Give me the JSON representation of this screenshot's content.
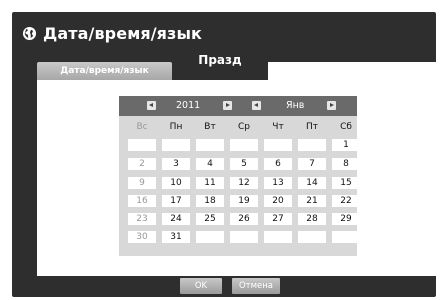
{
  "window": {
    "title": "Дата/время/язык",
    "title_icon": "globe-icon"
  },
  "tabs": [
    {
      "label": "Дата/время/язык",
      "active": false
    },
    {
      "label": "Празд",
      "active": true
    }
  ],
  "calendar": {
    "year": "2011",
    "month": "Янв",
    "weekdays": [
      "Вс",
      "Пн",
      "Вт",
      "Ср",
      "Чт",
      "Пт",
      "Сб"
    ],
    "weeks": [
      [
        "",
        "",
        "",
        "",
        "",
        "",
        "1"
      ],
      [
        "2",
        "3",
        "4",
        "5",
        "6",
        "7",
        "8"
      ],
      [
        "9",
        "10",
        "11",
        "12",
        "13",
        "14",
        "15"
      ],
      [
        "16",
        "17",
        "18",
        "19",
        "20",
        "21",
        "22"
      ],
      [
        "23",
        "24",
        "25",
        "26",
        "27",
        "28",
        "29"
      ],
      [
        "30",
        "31",
        "",
        "",
        "",
        "",
        ""
      ]
    ],
    "nav_icons": [
      "prev-year-icon",
      "next-year-icon",
      "prev-month-icon",
      "next-month-icon"
    ]
  },
  "buttons": {
    "ok": "OK",
    "cancel": "Отмена"
  },
  "colors": {
    "frame": "#2e2e2e",
    "header": "#6a6a6a",
    "grid": "#d8d8d8",
    "sunday_text": "#999999"
  }
}
